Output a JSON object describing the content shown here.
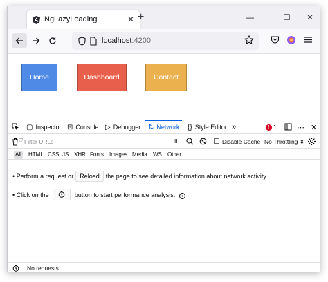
{
  "tab": {
    "title": "NgLazyLoading",
    "close": "✕"
  },
  "newtab": "+",
  "window_controls": {
    "minimize": "—",
    "maximize": "☐",
    "close": "✕"
  },
  "url": {
    "host": "localhost",
    "port": ":4200"
  },
  "page": {
    "buttons": [
      {
        "label": "Home",
        "color": "#4f8ae6"
      },
      {
        "label": "Dashboard",
        "color": "#e8604c"
      },
      {
        "label": "Contact",
        "color": "#ecb14f"
      }
    ]
  },
  "devtools": {
    "tabs": [
      "Inspector",
      "Console",
      "Debugger",
      "Network",
      "Style Editor"
    ],
    "active_tab": "Network",
    "error_count": "1",
    "filter_placeholder": "Filter URLs",
    "pause_glyph": "II",
    "disable_cache_label": "Disable Cache",
    "throttling": "No Throttling",
    "type_filters": [
      "All",
      "HTML",
      "CSS",
      "JS",
      "XHR",
      "Fonts",
      "Images",
      "Media",
      "WS",
      "Other"
    ],
    "msg1": {
      "prefix": "• Perform a request or",
      "button": "Reload",
      "suffix": "the page to see detailed information about network activity."
    },
    "msg2": {
      "prefix": "• Click on the",
      "suffix": "button to start performance analysis."
    },
    "status": "No requests"
  },
  "colors": {
    "accent": "#0060df",
    "error": "#d70022"
  }
}
